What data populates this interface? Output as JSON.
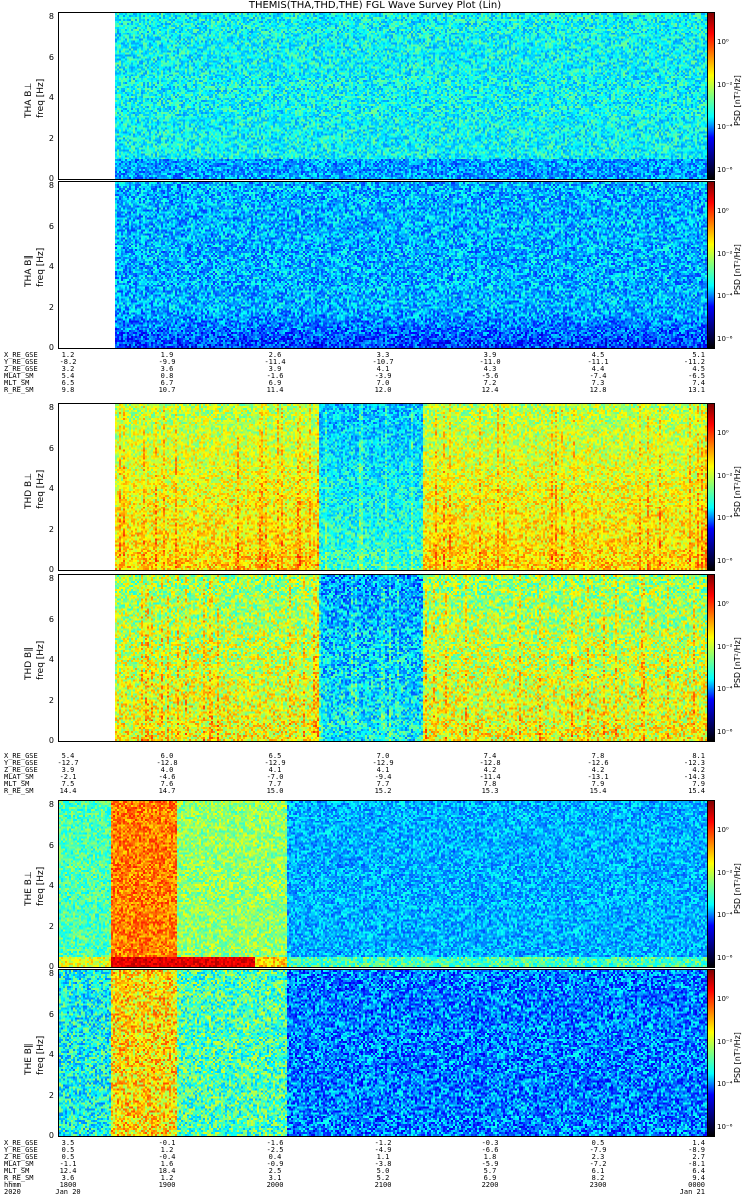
{
  "title": "THEMIS(THA,THD,THE) FGL Wave Survey Plot (Lin)",
  "chart_data": [
    {
      "type": "heatmap",
      "panel": "tha_bl",
      "ylabel": "THA B⊥",
      "yunit": "freq [Hz]",
      "ylim": [
        0,
        8
      ],
      "yticks": [
        "0",
        "2",
        "4",
        "6",
        "8"
      ],
      "zlabel": "PSD [nT²/Hz]",
      "zticks": [
        "10⁰",
        "10⁻²",
        "10⁻⁴",
        "10⁻⁶"
      ]
    },
    {
      "type": "heatmap",
      "panel": "tha_bll",
      "ylabel": "THA B∥",
      "yunit": "freq [Hz]",
      "ylim": [
        0,
        8
      ],
      "yticks": [
        "0",
        "2",
        "4",
        "6",
        "8"
      ],
      "zlabel": "PSD [nT²/Hz]",
      "zticks": [
        "10⁰",
        "10⁻²",
        "10⁻⁴",
        "10⁻⁶"
      ]
    },
    {
      "type": "heatmap",
      "panel": "thd_bl",
      "ylabel": "THD B⊥",
      "yunit": "freq [Hz]",
      "ylim": [
        0,
        8
      ],
      "yticks": [
        "0",
        "2",
        "4",
        "6",
        "8"
      ],
      "zlabel": "PSD [nT²/Hz]",
      "zticks": [
        "10⁰",
        "10⁻²",
        "10⁻⁴",
        "10⁻⁶"
      ]
    },
    {
      "type": "heatmap",
      "panel": "thd_bll",
      "ylabel": "THD B∥",
      "yunit": "freq [Hz]",
      "ylim": [
        0,
        8
      ],
      "yticks": [
        "0",
        "2",
        "4",
        "6",
        "8"
      ],
      "zlabel": "PSD [nT²/Hz]",
      "zticks": [
        "10⁰",
        "10⁻²",
        "10⁻⁴",
        "10⁻⁶"
      ]
    },
    {
      "type": "heatmap",
      "panel": "the_bl",
      "ylabel": "THE B⊥",
      "yunit": "freq [Hz]",
      "ylim": [
        0,
        8
      ],
      "yticks": [
        "0",
        "2",
        "4",
        "6",
        "8"
      ],
      "zlabel": "PSD [nT²/Hz]",
      "zticks": [
        "10⁰",
        "10⁻²",
        "10⁻⁴",
        "10⁻⁶"
      ]
    },
    {
      "type": "heatmap",
      "panel": "the_bll",
      "ylabel": "THE B∥",
      "yunit": "freq [Hz]",
      "ylim": [
        0,
        8
      ],
      "yticks": [
        "0",
        "2",
        "4",
        "6",
        "8"
      ],
      "zlabel": "PSD [nT²/Hz]",
      "zticks": [
        "10⁰",
        "10⁻²",
        "10⁻⁴",
        "10⁻⁶"
      ]
    }
  ],
  "ephemeris": [
    {
      "rows": [
        {
          "label": "X_RE_GSE",
          "values": [
            "1.2",
            "1.9",
            "2.6",
            "3.3",
            "3.9",
            "4.5",
            "5.1"
          ]
        },
        {
          "label": "Y_RE_GSE",
          "values": [
            "-8.2",
            "-9.9",
            "-11.4",
            "-10.7",
            "-11.0",
            "-11.1",
            "-11.2"
          ]
        },
        {
          "label": "Z_RE_GSE",
          "values": [
            "3.2",
            "3.6",
            "3.9",
            "4.1",
            "4.3",
            "4.4",
            "4.5"
          ]
        },
        {
          "label": "MLAT_SM",
          "values": [
            "5.4",
            "0.8",
            "-1.6",
            "-3.9",
            "-5.6",
            "-7.4",
            "-6.5"
          ]
        },
        {
          "label": "MLT_SM",
          "values": [
            "6.5",
            "6.7",
            "6.9",
            "7.0",
            "7.2",
            "7.3",
            "7.4"
          ]
        },
        {
          "label": "R_RE_SM",
          "values": [
            "9.8",
            "10.7",
            "11.4",
            "12.0",
            "12.4",
            "12.8",
            "13.1"
          ]
        }
      ]
    },
    {
      "rows": [
        {
          "label": "X_RE_GSE",
          "values": [
            "5.4",
            "6.0",
            "6.5",
            "7.0",
            "7.4",
            "7.8",
            "8.1"
          ]
        },
        {
          "label": "Y_RE_GSE",
          "values": [
            "-12.7",
            "-12.8",
            "-12.9",
            "-12.9",
            "-12.8",
            "-12.6",
            "-12.3"
          ]
        },
        {
          "label": "Z_RE_GSE",
          "values": [
            "3.9",
            "4.0",
            "4.1",
            "4.1",
            "4.2",
            "4.2",
            "4.2"
          ]
        },
        {
          "label": "MLAT_SM",
          "values": [
            "-2.1",
            "-4.6",
            "-7.0",
            "-9.4",
            "-11.4",
            "-13.1",
            "-14.3"
          ]
        },
        {
          "label": "MLT_SM",
          "values": [
            "7.5",
            "7.6",
            "7.7",
            "7.7",
            "7.8",
            "7.9",
            "7.9"
          ]
        },
        {
          "label": "R_RE_SM",
          "values": [
            "14.4",
            "14.7",
            "15.0",
            "15.2",
            "15.3",
            "15.4",
            "15.4"
          ]
        }
      ]
    },
    {
      "rows": [
        {
          "label": "X_RE_GSE",
          "values": [
            "3.5",
            "-0.1",
            "-1.6",
            "-1.2",
            "-0.3",
            "0.5",
            "1.4"
          ]
        },
        {
          "label": "Y_RE_GSE",
          "values": [
            "0.5",
            "1.2",
            "-2.5",
            "-4.9",
            "-6.6",
            "-7.9",
            "-8.9"
          ]
        },
        {
          "label": "Z_RE_GSE",
          "values": [
            "0.5",
            "-0.4",
            "0.4",
            "1.1",
            "1.8",
            "2.3",
            "2.7"
          ]
        },
        {
          "label": "MLAT_SM",
          "values": [
            "-1.1",
            "1.6",
            "-0.9",
            "-3.8",
            "-5.9",
            "-7.2",
            "-8.1"
          ]
        },
        {
          "label": "MLT_SM",
          "values": [
            "12.4",
            "18.4",
            "2.5",
            "5.0",
            "5.7",
            "6.1",
            "6.4"
          ]
        },
        {
          "label": "R_RE_SM",
          "values": [
            "3.6",
            "1.2",
            "3.1",
            "5.2",
            "6.9",
            "8.2",
            "9.4"
          ]
        },
        {
          "label": "hhmm",
          "values": [
            "1800",
            "1900",
            "2000",
            "2100",
            "2200",
            "2300",
            "0000"
          ]
        },
        {
          "label": "2020",
          "values": [
            "Jan 20",
            "",
            "",
            "",
            "",
            "",
            "Jan 21"
          ]
        }
      ]
    }
  ]
}
